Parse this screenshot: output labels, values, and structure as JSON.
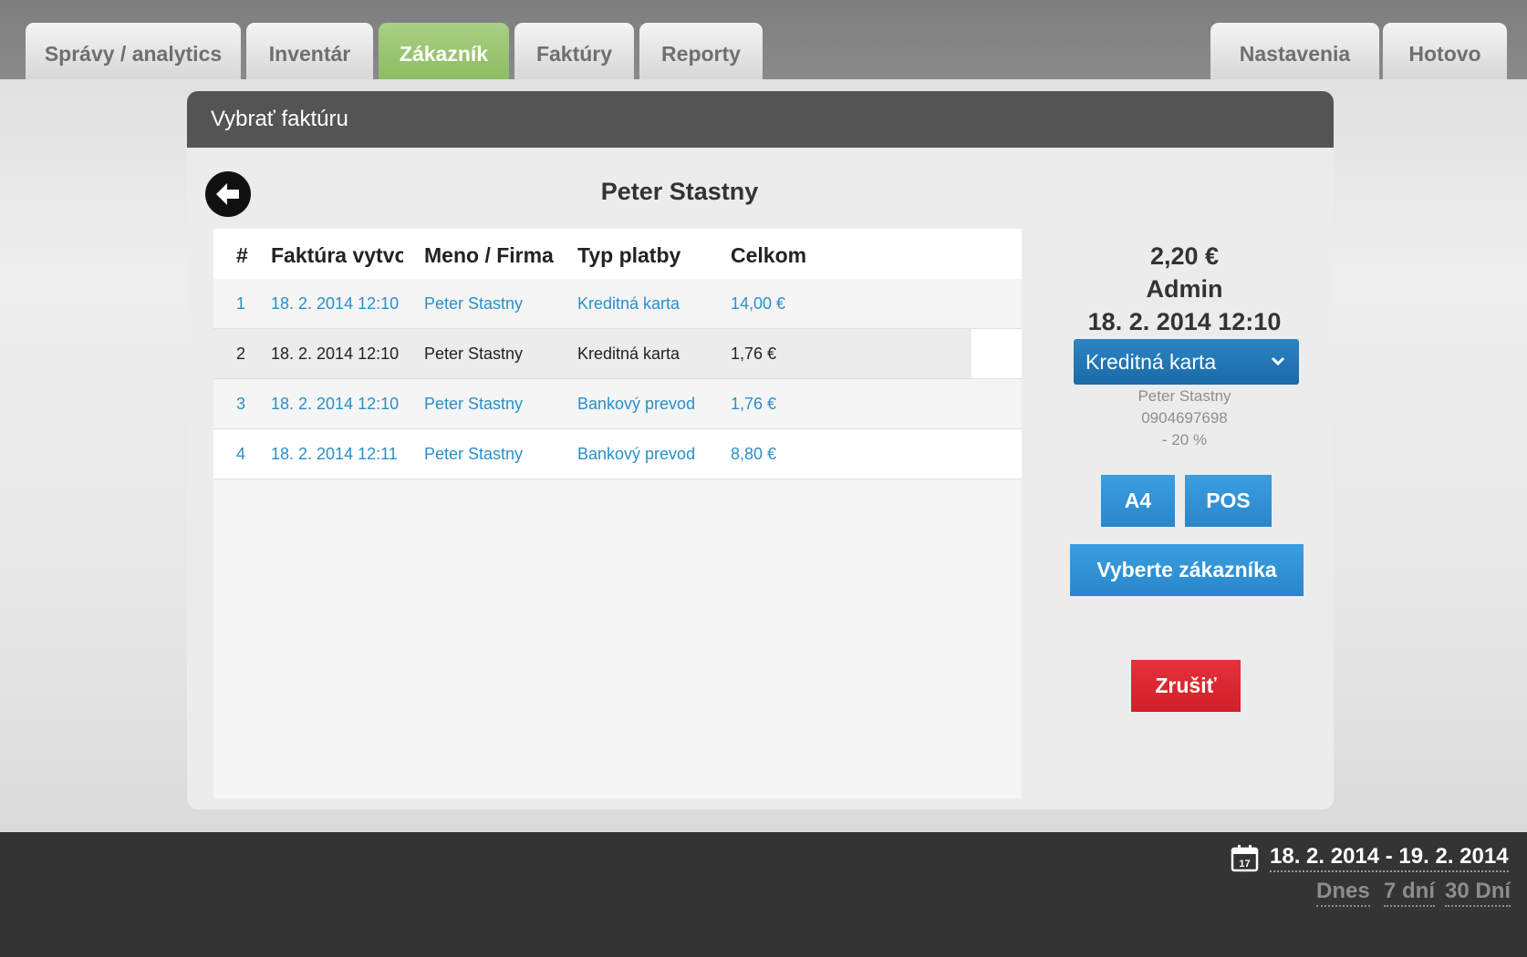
{
  "tabs": [
    {
      "label": "Správy / analytics",
      "active": false
    },
    {
      "label": "Inventár",
      "active": false
    },
    {
      "label": "Zákazník",
      "active": true
    },
    {
      "label": "Faktúry",
      "active": false
    },
    {
      "label": "Reporty",
      "active": false
    }
  ],
  "right_tabs": [
    {
      "label": "Nastavenia"
    },
    {
      "label": "Hotovo"
    }
  ],
  "panel": {
    "title": "Vybrať faktúru",
    "customer_name": "Peter Stastny",
    "back_icon": "arrow-left-icon"
  },
  "table": {
    "headers": [
      "#",
      "Faktúra vytvorená",
      "Meno / Firma",
      "Typ platby",
      "Celkom"
    ],
    "rows": [
      {
        "num": "1",
        "created": "18. 2. 2014 12:10",
        "name": "Peter Stastny",
        "payment": "Kreditná karta",
        "total": "14,00 €",
        "style": "link"
      },
      {
        "num": "2",
        "created": "18. 2. 2014 12:10",
        "name": "Peter Stastny",
        "payment": "Kreditná karta",
        "total": "1,76 €",
        "style": "plain"
      },
      {
        "num": "3",
        "created": "18. 2. 2014 12:10",
        "name": "Peter Stastny",
        "payment": "Bankový prevod",
        "total": "1,76 €",
        "style": "link"
      },
      {
        "num": "4",
        "created": "18. 2. 2014 12:11",
        "name": "Peter Stastny",
        "payment": "Bankový prevod",
        "total": "8,80 €",
        "style": "link"
      }
    ]
  },
  "detail": {
    "amount": "2,20 €",
    "user": "Admin",
    "datetime": "18. 2. 2014 12:10",
    "payment_selected": "Kreditná karta",
    "customer_name": "Peter Stastny",
    "phone": "0904697698",
    "discount": "- 20 %",
    "print_a4": "A4",
    "print_pos": "POS",
    "select_customer": "Vyberte zákazníka",
    "cancel": "Zrušiť"
  },
  "footer": {
    "date_range": "18. 2. 2014 - 19. 2. 2014",
    "calendar_day": "17",
    "quick_ranges": [
      "Dnes",
      "7 dní",
      "30 Dní"
    ]
  },
  "colors": {
    "active_tab": "#9bc672",
    "header_bar": "#545454",
    "link_blue": "#2a8fc9",
    "button_blue": "#2a86cb",
    "cancel_red": "#d9252e",
    "footer_bg": "#343434"
  }
}
